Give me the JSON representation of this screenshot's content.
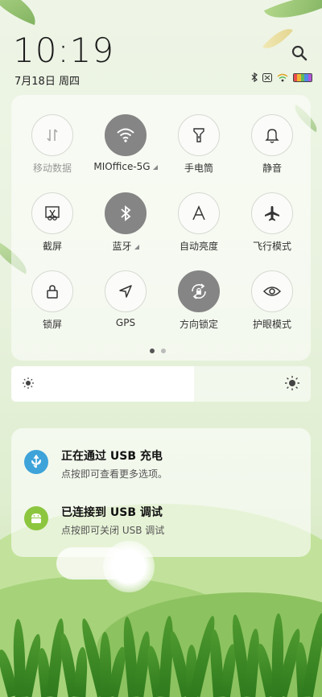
{
  "status_bar": {
    "time": "10:19",
    "date": "7月18日 周四",
    "battery_colors": [
      "#e84e4e",
      "#f2b533",
      "#5dbb5b",
      "#4f8be8",
      "#b056d8"
    ]
  },
  "toggles": [
    {
      "label": "移动数据",
      "icon": "mobile-data-icon",
      "active": false,
      "dim": true
    },
    {
      "label": "MIOffice-5G",
      "icon": "wifi-icon",
      "active": true,
      "dim": false
    },
    {
      "label": "手电筒",
      "icon": "flashlight-icon",
      "active": false,
      "dim": false
    },
    {
      "label": "静音",
      "icon": "bell-icon",
      "active": false,
      "dim": false
    },
    {
      "label": "截屏",
      "icon": "screenshot-icon",
      "active": false,
      "dim": false
    },
    {
      "label": "蓝牙",
      "icon": "bluetooth-icon",
      "active": true,
      "dim": false
    },
    {
      "label": "自动亮度",
      "icon": "auto-brightness-icon",
      "active": false,
      "dim": false
    },
    {
      "label": "飞行模式",
      "icon": "airplane-icon",
      "active": false,
      "dim": false
    },
    {
      "label": "锁屏",
      "icon": "lock-icon",
      "active": false,
      "dim": false
    },
    {
      "label": "GPS",
      "icon": "location-icon",
      "active": false,
      "dim": false
    },
    {
      "label": "方向锁定",
      "icon": "rotation-lock-icon",
      "active": true,
      "dim": false
    },
    {
      "label": "护眼模式",
      "icon": "eye-icon",
      "active": false,
      "dim": false
    }
  ],
  "pager": {
    "current": 1,
    "total": 2
  },
  "brightness": {
    "level": 0.61
  },
  "notifications": [
    {
      "title": "正在通过 USB 充电",
      "subtitle": "点按即可查看更多选项。",
      "icon": "usb-icon",
      "color": "#3ea3d9"
    },
    {
      "title": "已连接到 USB 调试",
      "subtitle": "点按即可关闭 USB 调试",
      "icon": "android-icon",
      "color": "#8cc63f"
    }
  ]
}
